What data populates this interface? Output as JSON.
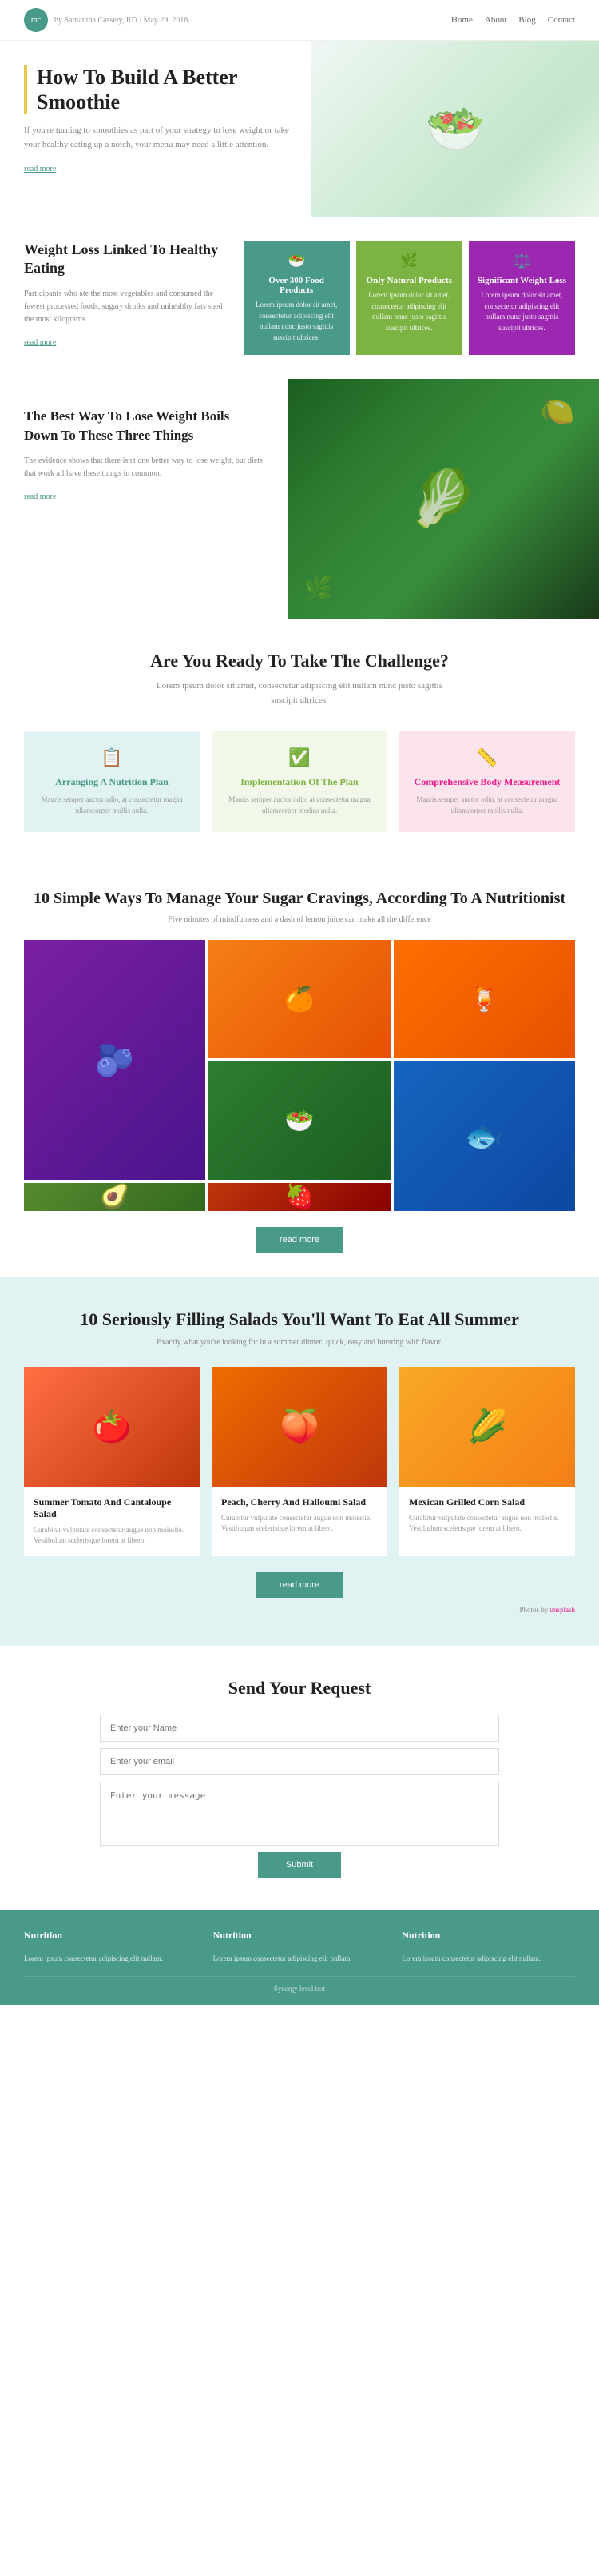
{
  "header": {
    "author": "by Samantha Cassety, RD / May 29, 2018",
    "logo_text": "mc",
    "nav_items": [
      "Home",
      "About",
      "Blog",
      "Contact"
    ]
  },
  "hero": {
    "title": "How To Build A Better Smoothie",
    "text": "If you're turning to smoothies as part of your strategy to lose weight or take your healthy eating up a notch, your menu may need a little attention.",
    "readmore": "read more"
  },
  "weight_loss": {
    "title": "Weight Loss Linked To Healthy Eating",
    "text": "Participants who ate the most vegetables and consumed the fewest processed foods, sugary drinks and unhealthy fats shed the most kilograms",
    "readmore": "read more",
    "cards": [
      {
        "icon": "🥗",
        "title": "Over 300 Food Products",
        "text": "Lorem ipsum dolor sit amet, consectetur adipiscing elit nullam nunc justo sagittis suscipit ultrices."
      },
      {
        "icon": "🌿",
        "title": "Only Natural Products",
        "text": "Lorem ipsum dolor sit amet, consectetur adipiscing elit nullam nunc justo sagittis suscipit ultrices."
      },
      {
        "icon": "⚖️",
        "title": "Significant Weight Loss",
        "text": "Lorem ipsum dolor sit amet, consectetur adipiscing elit nullam nunc justo sagittis suscipit ultrices."
      }
    ]
  },
  "best_way": {
    "title": "The Best Way To Lose Weight Boils Down To These Three Things",
    "text": "The evidence shows that there isn't one better way to lose weight, but diets that work all have these things in common.",
    "readmore": "read more"
  },
  "challenge": {
    "title": "Are You Ready To Take The Challenge?",
    "subtitle": "Lorem ipsum dolor sit amet, consectetur adipiscing elit nullam nunc justo sagittis suscipit ultrices.",
    "cards": [
      {
        "icon": "📋",
        "title": "Arranging A Nutrition Plan",
        "text": "Mauris semper auctor odio, at consectetur magna ullamcorper mollis nulla."
      },
      {
        "icon": "✅",
        "title": "Implementation Of The Plan",
        "text": "Mauris semper auctor odio, at consectetur magna ullamcorper medius nulla."
      },
      {
        "icon": "📏",
        "title": "Comprehensive Body Measurement",
        "text": "Mauris semper auctor odio, at consectetur magna ullamcorper mollis nulla."
      }
    ]
  },
  "sugar": {
    "title": "10 Simple Ways To Manage Your Sugar Cravings, According To A Nutritionist",
    "subtitle": "Five minutes of mindfulness and a dash of lemon juice can make all the difference",
    "readmore": "read more"
  },
  "salads": {
    "title": "10 Seriously Filling Salads You'll Want To Eat All Summer",
    "subtitle": "Exactly what you're looking for in a summer dinner: quick, easy and bursting with flavor.",
    "cards": [
      {
        "name": "Summer Tomato And Cantaloupe Salad",
        "desc": "Curabitur vulputate consectetur augue non molestie. Vestibulum scelerisque lorem at libero."
      },
      {
        "name": "Peach, Cherry And Halloumi Salad",
        "desc": "Curabitur vulputate consectetur augue non molestie. Vestibulum scelerisque lorem at libero."
      },
      {
        "name": "Mexican Grilled Corn Salad",
        "desc": "Curabitur vulputate consectetur augue non molestie. Vestibulum scelerisque lorem at libero."
      }
    ],
    "readmore": "read more",
    "photos_by": "Photos by",
    "photos_by_author": "unsplash"
  },
  "contact": {
    "title": "Send Your Request",
    "name_placeholder": "Enter your Name",
    "email_placeholder": "Enter your email",
    "message_placeholder": "Enter your message",
    "submit_label": "Submit"
  },
  "footer": {
    "cols": [
      {
        "title": "Nutrition",
        "text": "Lorem ipsum consectetur adipiscing elit nullam."
      },
      {
        "title": "Nutrition",
        "text": "Lorem ipsum consectetur adipiscing elit nullam."
      },
      {
        "title": "Nutrition",
        "text": "Lorem ipsum consectetur adipiscing elit nullam."
      }
    ],
    "bottom": "Synergy level test"
  }
}
